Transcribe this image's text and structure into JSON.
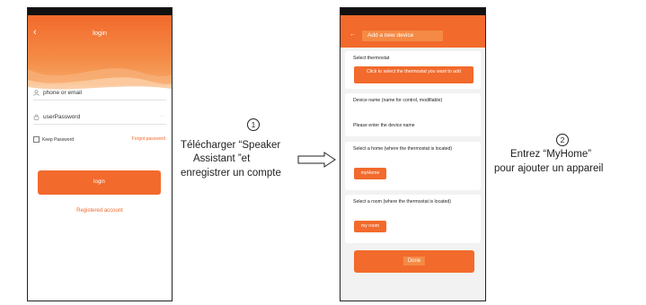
{
  "phone1": {
    "title": "login",
    "back_glyph": "‹",
    "username_label": "phone or email",
    "password_label": "userPassword",
    "password_eye": "···",
    "keep_password": "Keep Password",
    "forgot_password": "Forgot password",
    "login_button": "login",
    "registered_link": "Registered account"
  },
  "phone2": {
    "back_glyph": "←",
    "title": "Add a new device",
    "thermostat_section": "Select thermostat",
    "thermostat_button": "Click to select the thermostat you want to add",
    "device_name_label": "Device name (name for control, modifiable)",
    "device_name_placeholder": "Please enter the device name",
    "home_label": "Select a home (where the thermostat is located)",
    "home_value": "myHome",
    "room_label": "Select a room (where the thermostat is located)",
    "room_value": "my room",
    "done_button": "Done"
  },
  "annotations": {
    "step1_number": "1",
    "step1_text": [
      "Télécharger “Speaker",
      "Assistant ”et",
      "enregistrer un compte"
    ],
    "step2_number": "2",
    "step2_text": [
      "Entrez “MyHome”",
      "pour ajouter un appareil"
    ]
  },
  "colors": {
    "accent": "#f26a2c",
    "accent_light": "#f48a45",
    "card_bg": "#f2f2f2"
  }
}
